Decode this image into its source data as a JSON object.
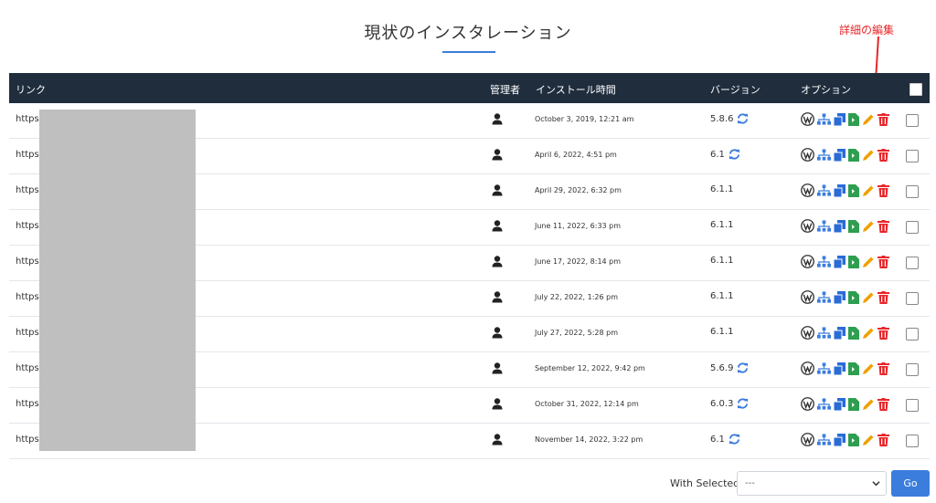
{
  "page": {
    "title": "現状のインスタレーション"
  },
  "annotation": {
    "label": "詳細の編集",
    "color": "#e8262a"
  },
  "table": {
    "headers": {
      "link": "リンク",
      "admin": "管理者",
      "install_time": "インストール時間",
      "version": "バージョン",
      "options": "オプション"
    },
    "rows": [
      {
        "link": "https",
        "time": "October 3, 2019, 12:21 am",
        "version": "5.8.6",
        "update": true
      },
      {
        "link": "https",
        "time": "April 6, 2022, 4:51 pm",
        "version": "6.1",
        "update": true
      },
      {
        "link": "https",
        "time": "April 29, 2022, 6:32 pm",
        "version": "6.1.1",
        "update": false
      },
      {
        "link": "https",
        "time": "June 11, 2022, 6:33 pm",
        "version": "6.1.1",
        "update": false
      },
      {
        "link": "https",
        "time": "June 17, 2022, 8:14 pm",
        "version": "6.1.1",
        "update": false
      },
      {
        "link": "https",
        "time": "July 22, 2022, 1:26 pm",
        "version": "6.1.1",
        "update": false
      },
      {
        "link": "https",
        "time": "July 27, 2022, 5:28 pm",
        "version": "6.1.1",
        "update": false
      },
      {
        "link": "https",
        "time": "September 12, 2022, 9:42 pm",
        "version": "5.6.9",
        "update": true
      },
      {
        "link": "https",
        "time": "October 31, 2022, 12:14 pm",
        "version": "6.0.3",
        "update": true
      },
      {
        "link": "https",
        "time": "November 14, 2022, 3:22 pm",
        "version": "6.1",
        "update": true
      }
    ]
  },
  "bulk": {
    "label": "With Selected:",
    "selected": "---",
    "go_label": "Go"
  },
  "colors": {
    "header_bg": "#1f2d3d",
    "accent": "#3b7ddd",
    "wp": "#333333",
    "network": "#3b7ddd",
    "clone": "#2a6bd6",
    "staging": "#2e9e4f",
    "edit": "#f0a000",
    "delete": "#e8262a"
  },
  "icons": {
    "admin": "user-icon",
    "update": "refresh-icon",
    "options": [
      "wordpress-icon",
      "network-icon",
      "clone-icon",
      "staging-icon",
      "edit-icon",
      "delete-icon"
    ]
  }
}
